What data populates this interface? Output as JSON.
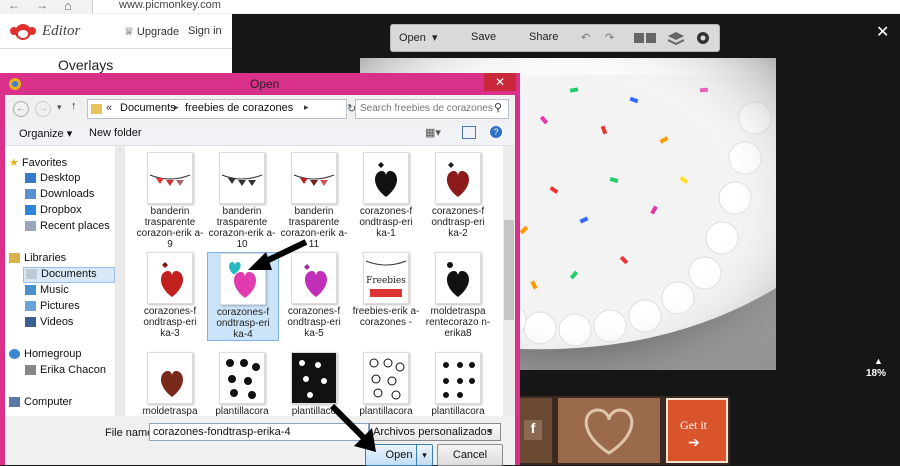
{
  "browser": {
    "url": "www.picmonkey.com",
    "back_glyph": "←",
    "fwd_glyph": "→",
    "home_glyph": "⌂"
  },
  "editor": {
    "logo_text": "Editor",
    "upgrade": "Upgrade",
    "sign_in": "Sign in",
    "overlays": "Overlays"
  },
  "toolbar": {
    "open": "Open",
    "save": "Save",
    "share": "Share"
  },
  "canvas": {
    "close": "✕",
    "zoom": "18%",
    "zoom_arrow": "▲",
    "thumb_label": "Get it"
  },
  "dialog": {
    "title": "Open",
    "close": "✕",
    "breadcrumb_prefix": "«",
    "crumb1": "Documents",
    "crumb2": "freebies de corazones",
    "search_placeholder": "Search freebies de corazones",
    "organize": "Organize",
    "new_folder": "New folder",
    "nav": {
      "favorites": "Favorites",
      "desktop": "Desktop",
      "downloads": "Downloads",
      "dropbox": "Dropbox",
      "recent": "Recent places",
      "libraries": "Libraries",
      "documents": "Documents",
      "music": "Music",
      "pictures": "Pictures",
      "videos": "Videos",
      "homegroup": "Homegroup",
      "user": "Erika Chacon",
      "computer": "Computer"
    },
    "files": [
      {
        "label": "banderin trasparente corazon-erik a-9"
      },
      {
        "label": "banderin trasparente corazon-erik a-10"
      },
      {
        "label": "banderin trasparente corazon-erik a-11"
      },
      {
        "label": "corazones-f ondtrasp-eri ka-1"
      },
      {
        "label": "corazones-f ondtrasp-eri ka-2"
      },
      {
        "label": "corazones-f ondtrasp-eri ka-3"
      },
      {
        "label": "corazones-f ondtrasp-eri ka-4"
      },
      {
        "label": "corazones-f ondtrasp-eri ka-5"
      },
      {
        "label": "freebies-erik a-corazones -"
      },
      {
        "label": "moldetraspa rentecorazo n-erika8"
      },
      {
        "label": "moldetraspa"
      },
      {
        "label": "plantillacora"
      },
      {
        "label": "plantillaco"
      },
      {
        "label": "plantillacora"
      },
      {
        "label": "plantillacora"
      }
    ],
    "filename_label": "File name:",
    "filename_value": "corazones-fondtrasp-erika-4",
    "filetype_value": "Archivos personalizados",
    "open_btn": "Open",
    "cancel_btn": "Cancel",
    "freebies_thumb_text": "Freebies"
  },
  "colors": {
    "dialog_frame": "#d9318a",
    "selection": "#cce4fa"
  }
}
